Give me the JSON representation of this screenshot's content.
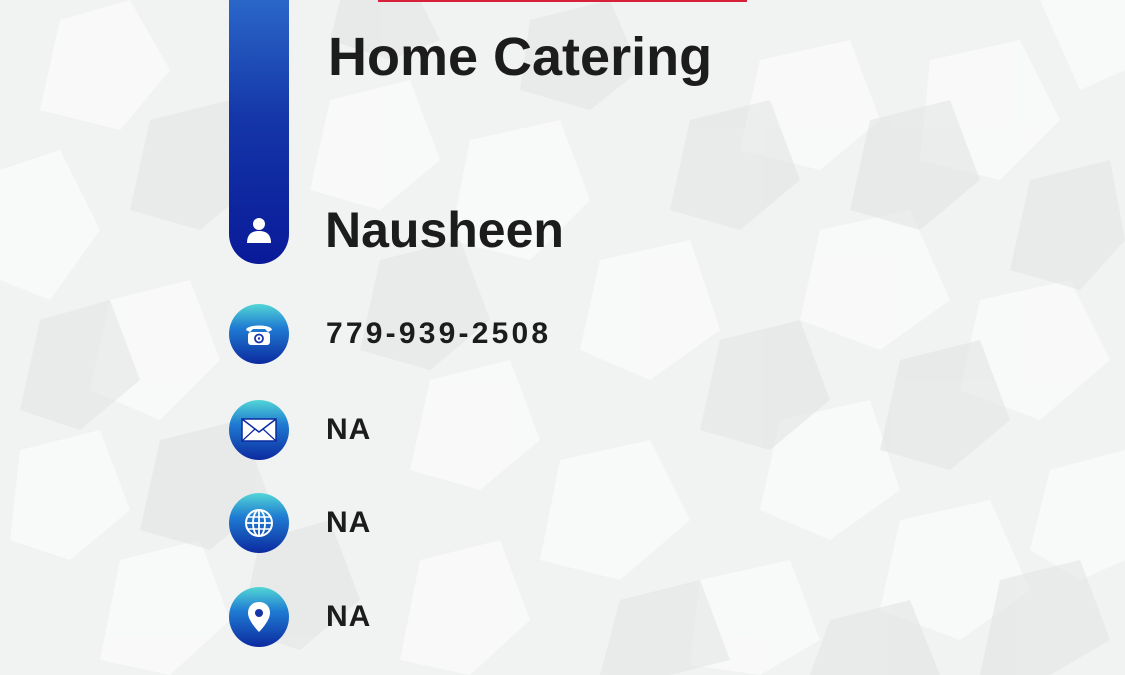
{
  "card": {
    "business_name": "Home Catering",
    "contact_name": "Nausheen",
    "accent_color": "#d8203a",
    "brand_color": "#0a1a99"
  },
  "contacts": {
    "phone": {
      "icon": "telephone-icon",
      "value": "779-939-2508"
    },
    "email": {
      "icon": "envelope-icon",
      "value": "NA"
    },
    "website": {
      "icon": "globe-icon",
      "value": "NA"
    },
    "address": {
      "icon": "location-pin-icon",
      "value": "NA"
    }
  },
  "person_icon": "person-icon"
}
